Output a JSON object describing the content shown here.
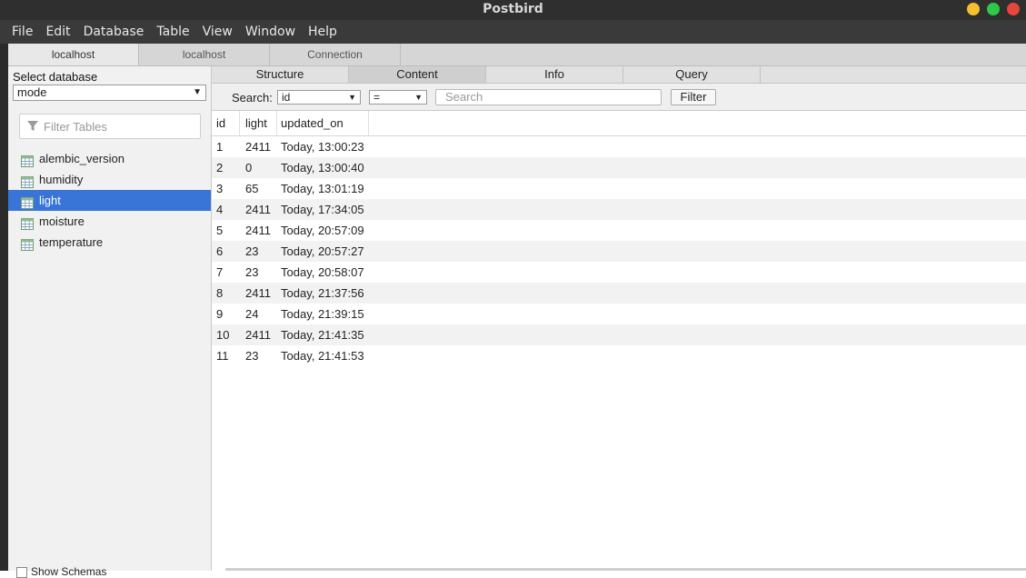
{
  "window": {
    "title": "Postbird"
  },
  "colors": {
    "close": "#e9453d",
    "maximize": "#2ec949",
    "minimize": "#f5bf30",
    "selection": "#3875d7"
  },
  "menu": [
    "File",
    "Edit",
    "Database",
    "Table",
    "View",
    "Window",
    "Help"
  ],
  "connection_tabs": [
    "localhost",
    "localhost",
    "Connection"
  ],
  "sidebar": {
    "select_db_label": "Select database",
    "selected_db": "mode",
    "filter_placeholder": "Filter Tables",
    "tables": [
      "alembic_version",
      "humidity",
      "light",
      "moisture",
      "temperature"
    ],
    "selected_table": "light",
    "show_schemas_label": "Show Schemas"
  },
  "view_tabs": [
    "Structure",
    "Content",
    "Info",
    "Query"
  ],
  "active_view_tab": "Content",
  "search": {
    "label": "Search:",
    "column": "id",
    "operator": "=",
    "placeholder": "Search",
    "button_label": "Filter"
  },
  "grid": {
    "columns": [
      "id",
      "light",
      "updated_on"
    ],
    "rows": [
      [
        "1",
        "2411",
        "Today, 13:00:23"
      ],
      [
        "2",
        "0",
        "Today, 13:00:40"
      ],
      [
        "3",
        "65",
        "Today, 13:01:19"
      ],
      [
        "4",
        "2411",
        "Today, 17:34:05"
      ],
      [
        "5",
        "2411",
        "Today, 20:57:09"
      ],
      [
        "6",
        "23",
        "Today, 20:57:27"
      ],
      [
        "7",
        "23",
        "Today, 20:58:07"
      ],
      [
        "8",
        "2411",
        "Today, 21:37:56"
      ],
      [
        "9",
        "24",
        "Today, 21:39:15"
      ],
      [
        "10",
        "2411",
        "Today, 21:41:35"
      ],
      [
        "11",
        "23",
        "Today, 21:41:53"
      ]
    ]
  }
}
